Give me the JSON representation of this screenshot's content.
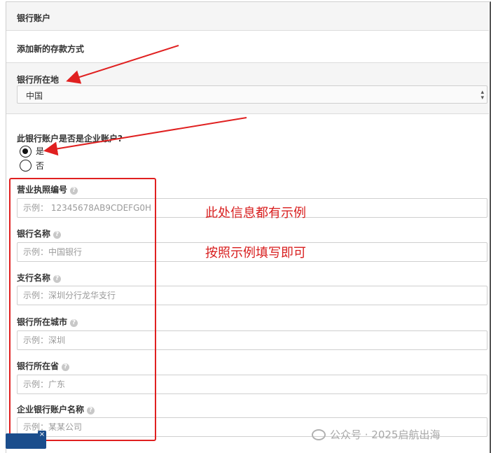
{
  "section": {
    "title": "银行账户",
    "subtitle": "添加新的存款方式"
  },
  "bank_location": {
    "label": "银行所在地",
    "value": "中国"
  },
  "corporate": {
    "question": "此银行账户是否是企业账户?",
    "options": [
      {
        "label": "是",
        "checked": true
      },
      {
        "label": "否",
        "checked": false
      }
    ]
  },
  "fields": [
    {
      "label": "营业执照编号",
      "placeholder": "示例： 12345678AB9CDEFG0H"
    },
    {
      "label": "银行名称",
      "placeholder": "示例：中国银行"
    },
    {
      "label": "支行名称",
      "placeholder": "示例：深圳分行龙华支行"
    },
    {
      "label": "银行所在城市",
      "placeholder": "示例：深圳"
    },
    {
      "label": "银行所在省",
      "placeholder": "示例：广东"
    },
    {
      "label": "企业银行账户名称",
      "placeholder": "示例：某某公司"
    }
  ],
  "annotations": [
    "此处信息都有示例",
    "按照示例填写即可"
  ],
  "watermark": "公众号 · 2025启航出海",
  "colors": {
    "annotation": "#e02020",
    "badge": "#1a4d8c"
  },
  "icons": [
    "help-icon",
    "arrow-icon",
    "wechat-logo-icon"
  ]
}
